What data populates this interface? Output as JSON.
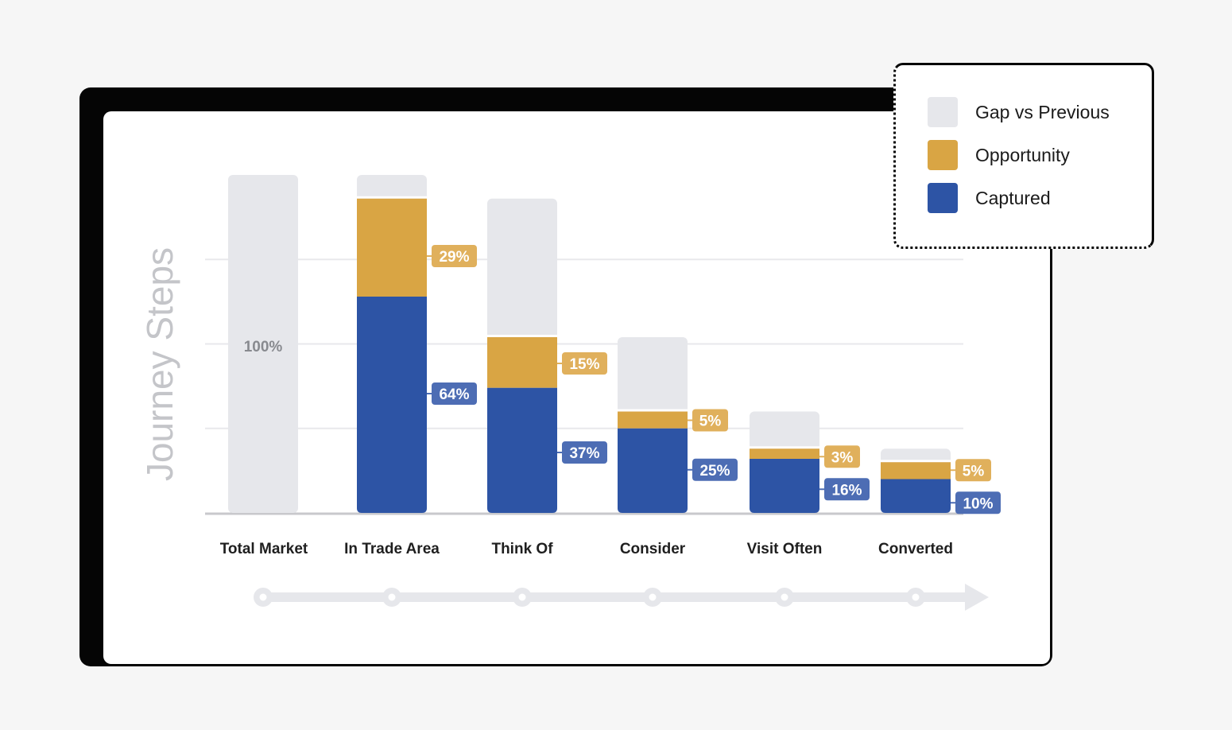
{
  "colors": {
    "gap": "#e6e7eb",
    "opportunity": "#d9a544",
    "captured": "#2d54a5",
    "opportunity_tag": "#e0b05c",
    "captured_tag": "#4d6db4",
    "gridline": "#e8e8ec",
    "axis": "#c8c8cc",
    "timeline": "#e6e7eb"
  },
  "legend": {
    "items": [
      {
        "label": "Gap vs Previous",
        "color": "#e6e7eb"
      },
      {
        "label": "Opportunity",
        "color": "#d9a544"
      },
      {
        "label": "Captured",
        "color": "#2d54a5"
      }
    ]
  },
  "chart_data": {
    "type": "bar",
    "stacked": true,
    "title": "",
    "xlabel": "",
    "ylabel": "Journey Steps",
    "ylim": [
      0,
      100
    ],
    "grid": true,
    "legend_position": "top-right",
    "categories": [
      "Total Market",
      "In Trade Area",
      "Think Of",
      "Consider",
      "Visit Often",
      "Converted"
    ],
    "series": [
      {
        "name": "Captured",
        "values": [
          null,
          64,
          37,
          25,
          16,
          10
        ]
      },
      {
        "name": "Opportunity",
        "values": [
          null,
          29,
          15,
          5,
          3,
          5
        ]
      },
      {
        "name": "Gap vs Previous",
        "values": [
          100,
          7,
          41,
          22,
          11,
          4
        ]
      }
    ],
    "bar_totals": [
      100,
      100,
      93,
      52,
      30,
      19
    ],
    "data_labels": {
      "total": [
        "100%",
        null,
        null,
        null,
        null,
        null
      ],
      "opportunity": [
        null,
        "29%",
        "15%",
        "5%",
        "3%",
        "5%"
      ],
      "captured": [
        null,
        "64%",
        "37%",
        "25%",
        "16%",
        "10%"
      ]
    },
    "timeline_steps": 6
  }
}
